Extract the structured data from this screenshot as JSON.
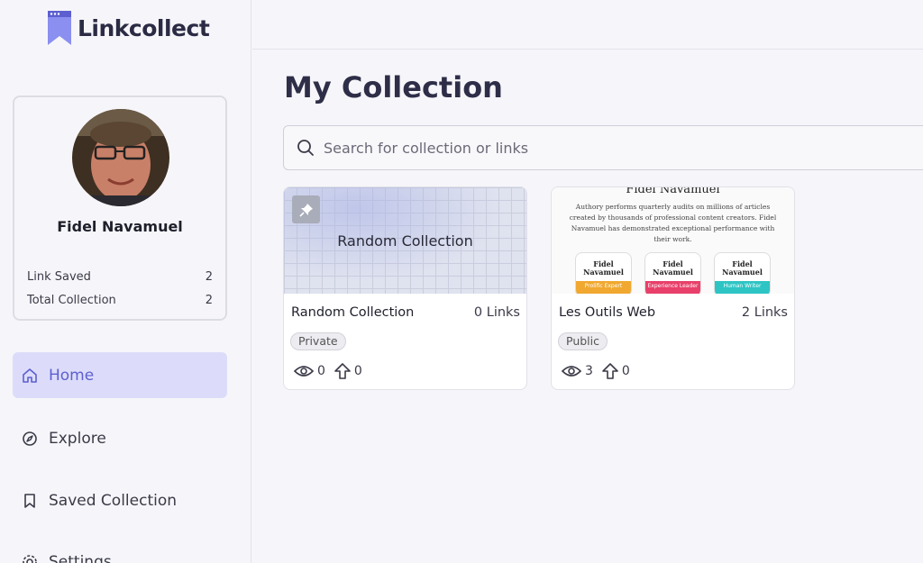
{
  "app": {
    "logo_text": "Linkcollect",
    "accent": "#5d5fd0"
  },
  "profile": {
    "name": "Fidel Navamuel",
    "stats": [
      {
        "label": "Link Saved",
        "value": "2"
      },
      {
        "label": "Total Collection",
        "value": "2"
      }
    ]
  },
  "nav": {
    "items": [
      {
        "label": "Home",
        "icon": "home-icon",
        "active": true
      },
      {
        "label": "Explore",
        "icon": "compass-icon"
      },
      {
        "label": "Saved Collection",
        "icon": "bookmark-icon"
      },
      {
        "label": "Settings",
        "icon": "gear-icon"
      }
    ]
  },
  "main": {
    "title": "My Collection",
    "search": {
      "placeholder": "Search for collection or links"
    },
    "collections": [
      {
        "thumb_title": "Random Collection",
        "title": "Random Collection",
        "links": "0 Links",
        "visibility": "Private",
        "views": "0",
        "upvotes": "0",
        "pinned": true
      },
      {
        "thumb_heading": "Fidel Navamuel",
        "thumb_text": "Authory performs quarterly audits on millions of articles created by thousands of professional content creators. Fidel Navamuel has demonstrated exceptional performance with their work.",
        "thumb_badges": [
          {
            "name": "Fidel Navamuel",
            "label": "Prolific Expert",
            "color": "#f0a830"
          },
          {
            "name": "Fidel Navamuel",
            "label": "Experience Leader",
            "color": "#e8406a"
          },
          {
            "name": "Fidel Navamuel",
            "label": "Human Writer",
            "color": "#2ec4c4"
          }
        ],
        "title": "Les Outils Web",
        "links": "2 Links",
        "visibility": "Public",
        "views": "3",
        "upvotes": "0"
      }
    ]
  }
}
